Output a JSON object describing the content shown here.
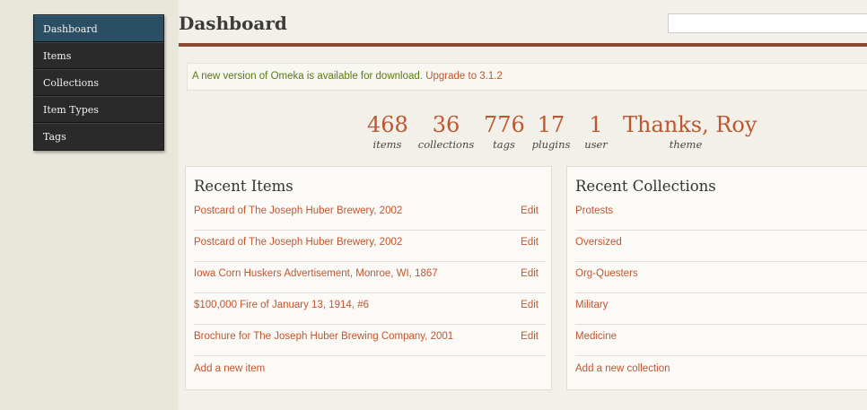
{
  "nav": {
    "items": [
      {
        "label": "Dashboard",
        "active": true
      },
      {
        "label": "Items"
      },
      {
        "label": "Collections"
      },
      {
        "label": "Item Types"
      },
      {
        "label": "Tags"
      }
    ]
  },
  "header": {
    "title": "Dashboard",
    "search_value": ""
  },
  "alert": {
    "message": "A new version of Omeka is available for download.",
    "link": "Upgrade to 3.1.2"
  },
  "stats": [
    {
      "value": "468",
      "label": "items"
    },
    {
      "value": "36",
      "label": "collections"
    },
    {
      "value": "776",
      "label": "tags"
    },
    {
      "value": "17",
      "label": "plugins"
    },
    {
      "value": "1",
      "label": "user"
    },
    {
      "value": "Thanks, Roy",
      "label": "theme"
    }
  ],
  "recent_items": {
    "title": "Recent Items",
    "edit_label": "Edit",
    "rows": [
      "Postcard of The Joseph Huber Brewery, 2002",
      "Postcard of The Joseph Huber Brewery, 2002",
      "Iowa Corn Huskers Advertisement, Monroe, WI, 1867",
      "$100,000 Fire of January 13, 1914, #6",
      "Brochure for The Joseph Huber Brewing Company, 2001"
    ],
    "add_label": "Add a new item"
  },
  "recent_collections": {
    "title": "Recent Collections",
    "rows": [
      "Protests",
      "Oversized",
      "Org-Questers",
      "Military",
      "Medicine"
    ],
    "add_label": "Add a new collection"
  },
  "colors": {
    "accent": "#c0562f",
    "nav_active": "#2a4e63",
    "rule": "#8c4a33",
    "alert_text": "#5a7a12"
  }
}
